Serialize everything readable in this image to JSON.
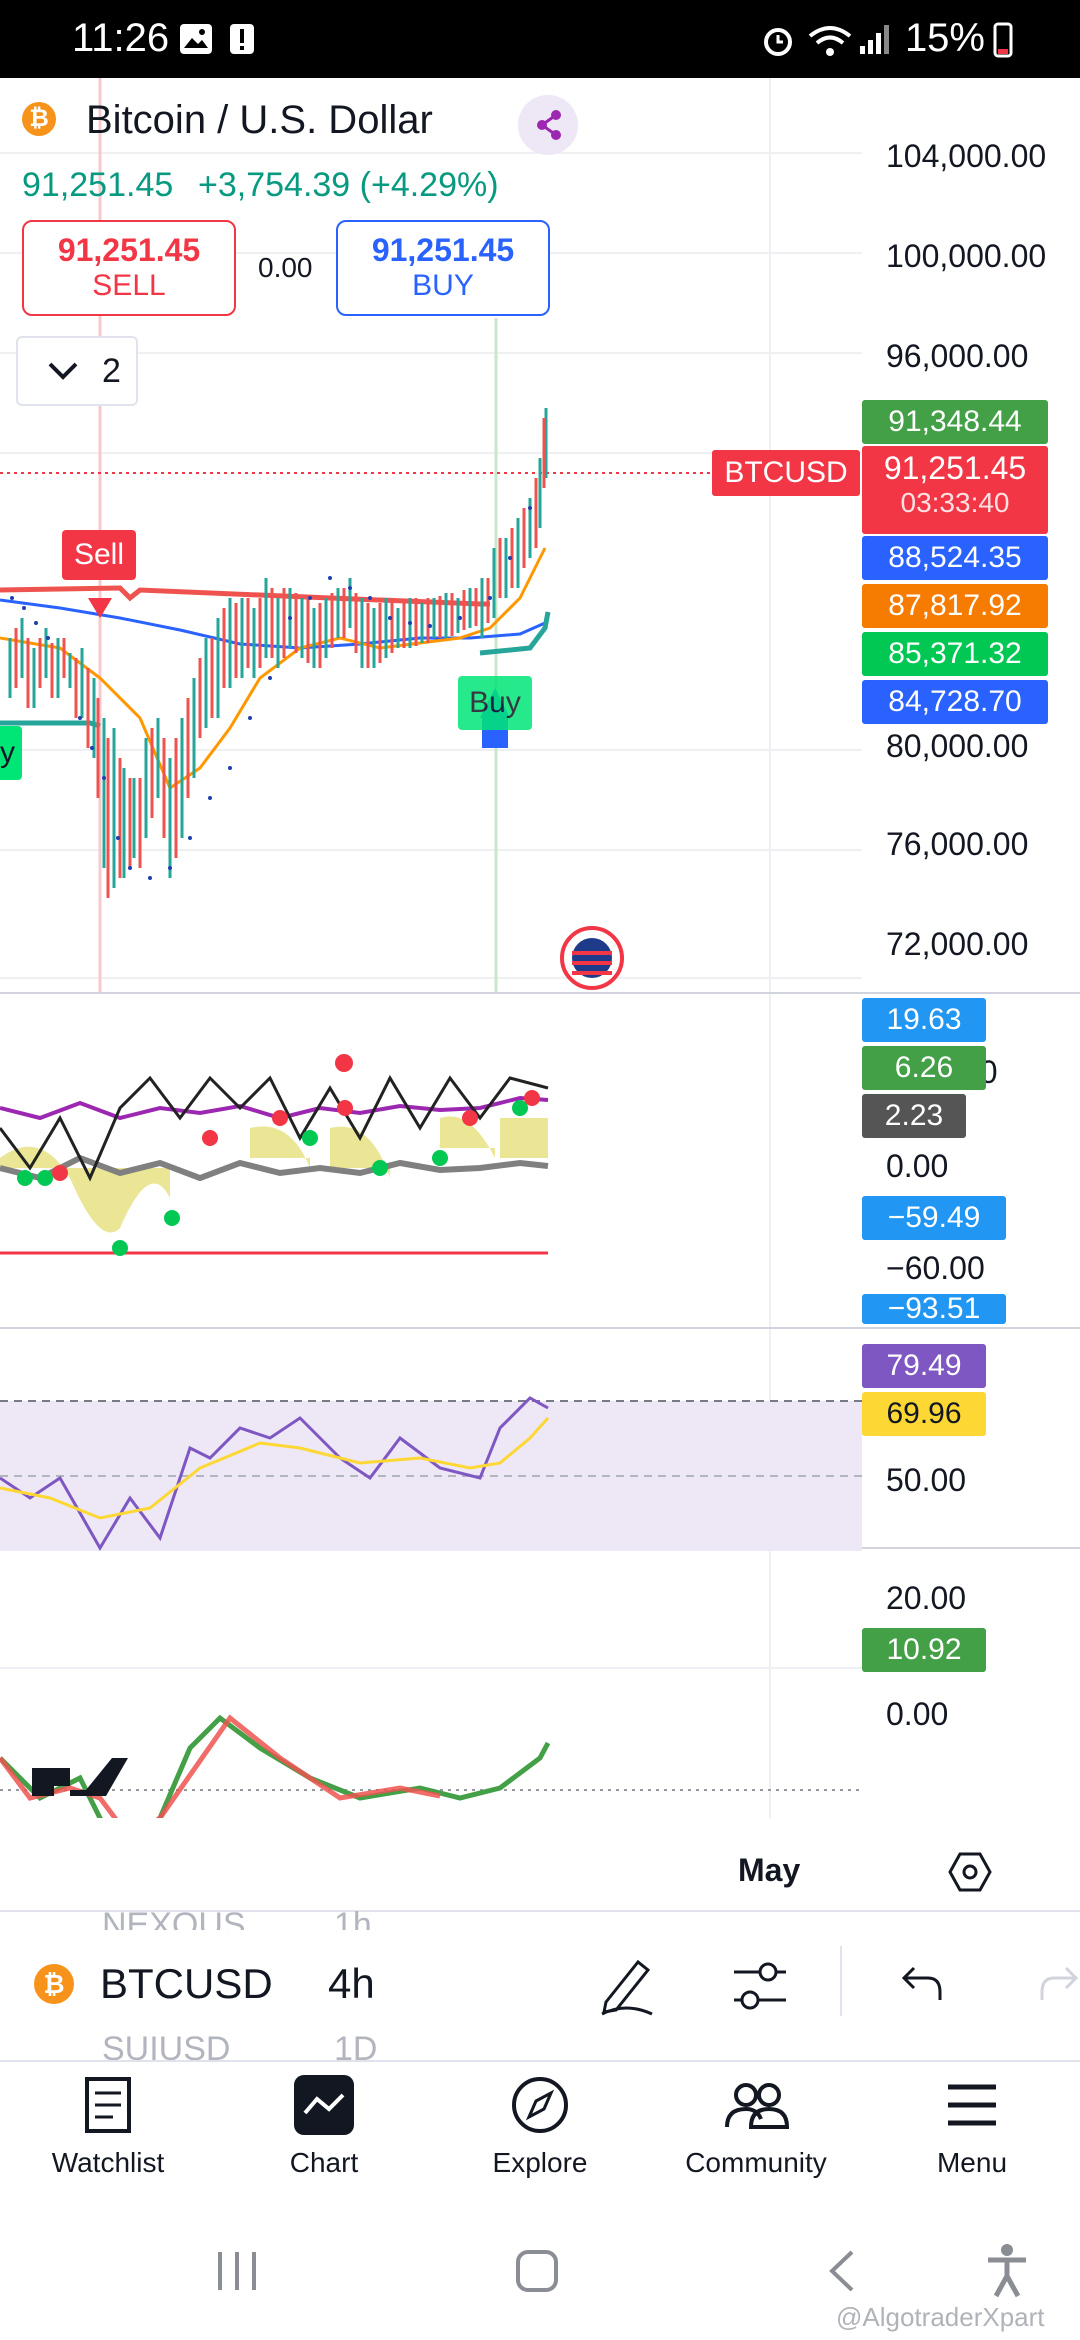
{
  "status_bar": {
    "time": "11:26",
    "battery": "15%"
  },
  "header": {
    "symbol_title": "Bitcoin / U.S. Dollar",
    "price_line": "91,251.45",
    "change_line": "+3,754.39 (+4.29%)",
    "sell_price": "91,251.45",
    "sell_label": "SELL",
    "spread": "0.00",
    "buy_price": "91,251.45",
    "buy_label": "BUY",
    "indicators_count": "2",
    "coin_glyph": "₿"
  },
  "price_axis": {
    "labels": [
      "104,000.00",
      "100,000.00",
      "96,000.00",
      "80,000.00",
      "76,000.00",
      "72,000.00"
    ]
  },
  "price_tags": {
    "tag1": "91,348.44",
    "symbol_tag": "BTCUSD",
    "current": "91,251.45",
    "countdown": "03:33:40",
    "tag3": "88,524.35",
    "tag4": "87,817.92",
    "tag5": "85,371.32",
    "tag6": "84,728.70"
  },
  "chart_annotations": {
    "sell": "Sell",
    "buy": "Buy",
    "buy_left": "y"
  },
  "indicator1": {
    "tag_a": "19.63",
    "tag_b": "6.26",
    "tag_c": "2.23",
    "axis_zero": "0.00",
    "tag_d": "−59.49",
    "axis_neg": "−60.00",
    "tag_e": "−93.51",
    "partial_label": "00"
  },
  "rsi": {
    "tag_a": "79.49",
    "tag_b": "69.96",
    "axis_50": "50.00"
  },
  "indicator3": {
    "axis_20": "20.00",
    "tag": "10.92",
    "axis_0": "0.00"
  },
  "time_axis": {
    "label": "May"
  },
  "symbol_bar": {
    "prev_symbol": "NEXOUS",
    "prev_interval": "1h",
    "symbol": "BTCUSD",
    "interval": "4h",
    "next_symbol": "SUIUSD",
    "next_interval": "1D"
  },
  "bottom_nav": {
    "items": [
      {
        "label": "Watchlist",
        "icon": "watchlist-icon"
      },
      {
        "label": "Chart",
        "icon": "chart-icon"
      },
      {
        "label": "Explore",
        "icon": "compass-icon"
      },
      {
        "label": "Community",
        "icon": "community-icon"
      },
      {
        "label": "Menu",
        "icon": "menu-icon"
      }
    ]
  },
  "watermark": "@AlgotraderXpart",
  "colors": {
    "green": "#26a69a",
    "red": "#f23645",
    "blue": "#2962ff",
    "orange": "#ff9800",
    "purple": "#7e57c2",
    "yellow": "#fdd835"
  }
}
